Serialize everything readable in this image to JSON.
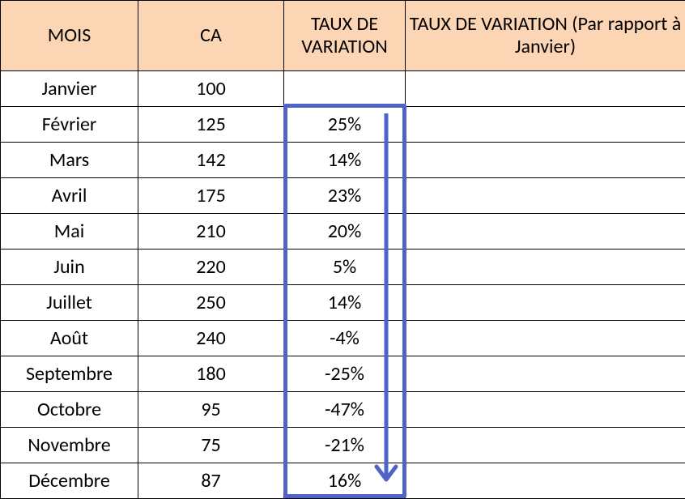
{
  "headers": {
    "col1": "MOIS",
    "col2": "CA",
    "col3": "TAUX DE VARIATION",
    "col4": "TAUX DE VARIATION (Par rapport à Janvier)"
  },
  "rows": [
    {
      "mois": "Janvier",
      "ca": "100",
      "taux": "",
      "taux_janv": ""
    },
    {
      "mois": "Février",
      "ca": "125",
      "taux": "25%",
      "taux_janv": ""
    },
    {
      "mois": "Mars",
      "ca": "142",
      "taux": "14%",
      "taux_janv": ""
    },
    {
      "mois": "Avril",
      "ca": "175",
      "taux": "23%",
      "taux_janv": ""
    },
    {
      "mois": "Mai",
      "ca": "210",
      "taux": "20%",
      "taux_janv": ""
    },
    {
      "mois": "Juin",
      "ca": "220",
      "taux": "5%",
      "taux_janv": ""
    },
    {
      "mois": "Juillet",
      "ca": "250",
      "taux": "14%",
      "taux_janv": ""
    },
    {
      "mois": "Août",
      "ca": "240",
      "taux": "-4%",
      "taux_janv": ""
    },
    {
      "mois": "Septembre",
      "ca": "180",
      "taux": "-25%",
      "taux_janv": ""
    },
    {
      "mois": "Octobre",
      "ca": "95",
      "taux": "-47%",
      "taux_janv": ""
    },
    {
      "mois": "Novembre",
      "ca": "75",
      "taux": "-21%",
      "taux_janv": ""
    },
    {
      "mois": "Décembre",
      "ca": "87",
      "taux": "16%",
      "taux_janv": ""
    }
  ]
}
